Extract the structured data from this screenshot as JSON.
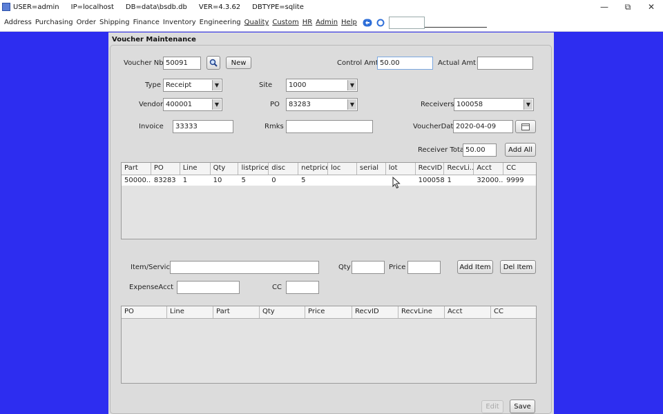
{
  "titlebar": {
    "segments": [
      "USER=admin",
      "IP=localhost",
      "DB=data\\bsdb.db",
      "VER=4.3.62",
      "DBTYPE=sqlite"
    ],
    "controls": [
      "—",
      "⧉",
      "✕"
    ]
  },
  "menu": {
    "items": [
      "Address",
      "Purchasing",
      "Order",
      "Shipping",
      "Finance",
      "Inventory",
      "Engineering",
      "Quality",
      "Custom",
      "HR",
      "Admin",
      "Help"
    ]
  },
  "frame": {
    "title": "Voucher Maintenance"
  },
  "form": {
    "voucher_nbr_label": "Voucher Nbr",
    "voucher_nbr": "50091",
    "new_button": "New",
    "control_amt_label": "Control Amt",
    "control_amt": "50.00",
    "actual_amt_label": "Actual Amt",
    "actual_amt": "",
    "type_label": "Type",
    "type": "Receipt",
    "site_label": "Site",
    "site": "1000",
    "vendor_label": "Vendor",
    "vendor": "400001",
    "po_label": "PO",
    "po": "83283",
    "receivers_label": "Receivers",
    "receivers": "100058",
    "invoice_label": "Invoice",
    "invoice": "33333",
    "rmks_label": "Rmks",
    "rmks": "",
    "voucherdate_label": "VoucherDate",
    "voucherdate": "2020-04-09",
    "receiver_total_label": "Receiver Total",
    "receiver_total": "50.00",
    "add_all_button": "Add All"
  },
  "receiver_table": {
    "columns": [
      "Part",
      "PO",
      "Line",
      "Qty",
      "listprice",
      "disc",
      "netprice",
      "loc",
      "serial",
      "lot",
      "RecvID",
      "RecvLi...",
      "Acct",
      "CC"
    ],
    "rows": [
      [
        "50000...",
        "83283",
        "1",
        "10",
        "5",
        "0",
        "5",
        "",
        "",
        "",
        "100058",
        "1",
        "32000...",
        "9999"
      ]
    ]
  },
  "item": {
    "item_service_label": "Item/Service",
    "item_service": "",
    "qty_label": "Qty",
    "qty": "",
    "price_label": "Price",
    "price": "",
    "add_item_button": "Add Item",
    "del_item_button": "Del Item",
    "expense_acct_label": "ExpenseAcct",
    "expense_acct": "",
    "cc_label": "CC",
    "cc": ""
  },
  "voucher_table": {
    "columns": [
      "PO",
      "Line",
      "Part",
      "Qty",
      "Price",
      "RecvID",
      "RecvLine",
      "Acct",
      "CC"
    ],
    "rows": []
  },
  "bottom": {
    "edit_button": "Edit",
    "save_button": "Save"
  },
  "colors": {
    "desktop": "#2d2df0",
    "frame": "#dcdcdc"
  },
  "icons": {
    "lookup": "search-icon",
    "calendar": "calendar-icon",
    "menu_a": "back-arrows-icon",
    "menu_b": "refresh-icon"
  }
}
